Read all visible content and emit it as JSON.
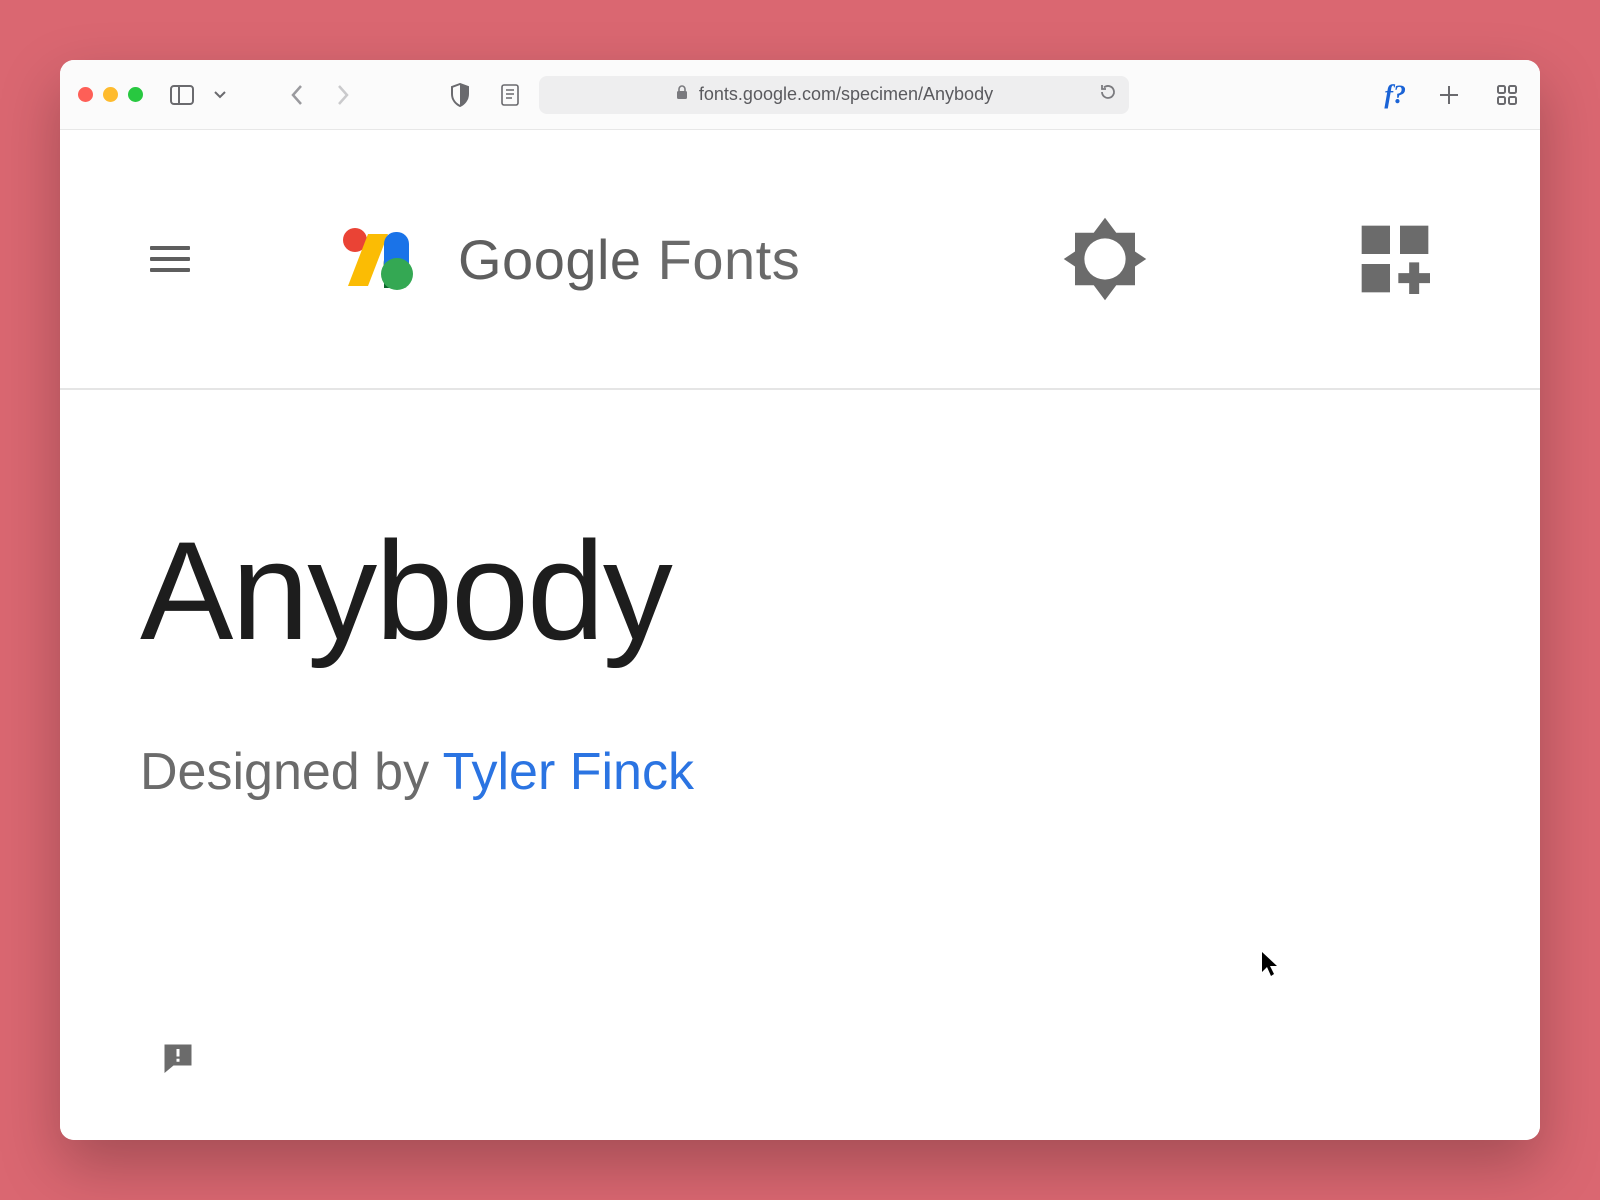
{
  "browser": {
    "url": "fonts.google.com/specimen/Anybody",
    "extension_label": "f?"
  },
  "header": {
    "brand_bold": "Google",
    "brand_light": " Fonts"
  },
  "specimen": {
    "font_name": "Anybody",
    "designed_by_prefix": "Designed by ",
    "designer_name": "Tyler Finck"
  }
}
